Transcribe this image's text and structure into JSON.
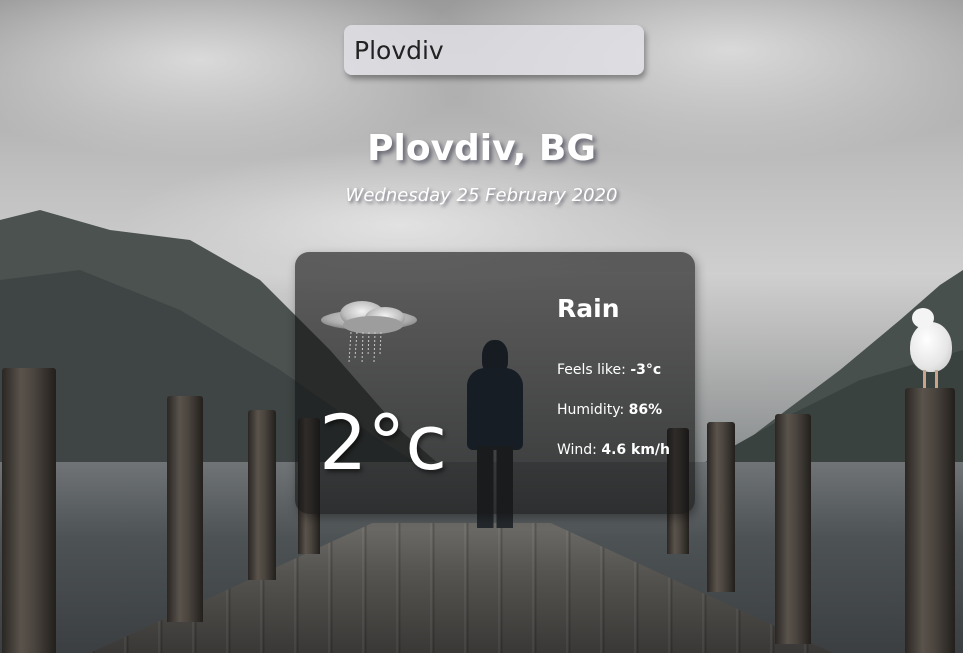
{
  "search": {
    "value": "Plovdiv"
  },
  "location": "Plovdiv, BG",
  "date": "Wednesday 25 February 2020",
  "weather": {
    "icon": "rain-cloud-icon",
    "temperature": "2°c",
    "condition": "Rain",
    "feels_like_label": "Feels like:",
    "feels_like_value": "-3°c",
    "humidity_label": "Humidity:",
    "humidity_value": "86%",
    "wind_label": "Wind:",
    "wind_value": "4.6 km/h"
  },
  "colors": {
    "text": "#ffffff",
    "card_background": "rgba(20,20,20,0.62)",
    "search_background": "rgba(225,225,230,0.82)"
  }
}
